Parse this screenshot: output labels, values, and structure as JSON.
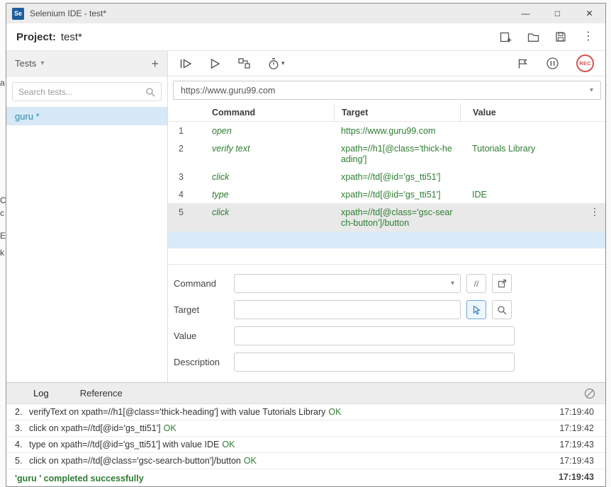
{
  "icons": {
    "minimize": "—",
    "maximize": "□",
    "close": "✕",
    "kebab": "⋮",
    "caret_down": "▾",
    "plus": "+"
  },
  "window": {
    "logo_text": "Se",
    "title": "Selenium IDE - test*"
  },
  "project_bar": {
    "label": "Project:",
    "name": "test*"
  },
  "sidebar": {
    "header": "Tests",
    "search_placeholder": "Search tests...",
    "tests": [
      {
        "name": "guru *"
      }
    ]
  },
  "toolbar": {
    "rec_label": "REC"
  },
  "url_bar": {
    "value": "https://www.guru99.com"
  },
  "table": {
    "columns": [
      "Command",
      "Target",
      "Value"
    ],
    "rows": [
      {
        "n": "1",
        "command": "open",
        "target": "https://www.guru99.com",
        "value": ""
      },
      {
        "n": "2",
        "command": "verify text",
        "target": "xpath=//h1[@class='thick-heading']",
        "value": "Tutorials Library"
      },
      {
        "n": "3",
        "command": "click",
        "target": "xpath=//td[@id='gs_tti51']",
        "value": ""
      },
      {
        "n": "4",
        "command": "type",
        "target": "xpath=//td[@id='gs_tti51']",
        "value": "IDE"
      },
      {
        "n": "5",
        "command": "click",
        "target": "xpath=//td[@class='gsc-search-button']/button",
        "value": ""
      }
    ]
  },
  "form": {
    "command_label": "Command",
    "target_label": "Target",
    "value_label": "Value",
    "description_label": "Description",
    "comment_toggle": "//"
  },
  "log": {
    "tabs": [
      "Log",
      "Reference"
    ],
    "entries": [
      {
        "num": "2.",
        "text": "verifyText on xpath=//h1[@class='thick-heading'] with value Tutorials Library",
        "status": "OK",
        "time": "17:19:40"
      },
      {
        "num": "3.",
        "text": "click on xpath=//td[@id='gs_tti51']",
        "status": "OK",
        "time": "17:19:42"
      },
      {
        "num": "4.",
        "text": "type on xpath=//td[@id='gs_tti51'] with value IDE",
        "status": "OK",
        "time": "17:19:43"
      },
      {
        "num": "5.",
        "text": "click on xpath=//td[@class='gsc-search-button']/button",
        "status": "OK",
        "time": "17:19:43"
      }
    ],
    "success": {
      "text": "'guru ' completed successfully",
      "time": "17:19:43"
    }
  },
  "background": {
    "fragments": [
      "a",
      "C",
      "c",
      "E",
      "k"
    ]
  },
  "colors": {
    "executed_green": "#2e7d32",
    "rec_red": "#d9534f",
    "selected_test_bg": "#d7e8f6",
    "selected_row_bg": "#e9e9e9",
    "insertion_row_bg": "#d9eaf8",
    "logo_blue": "#1d5d9b"
  }
}
